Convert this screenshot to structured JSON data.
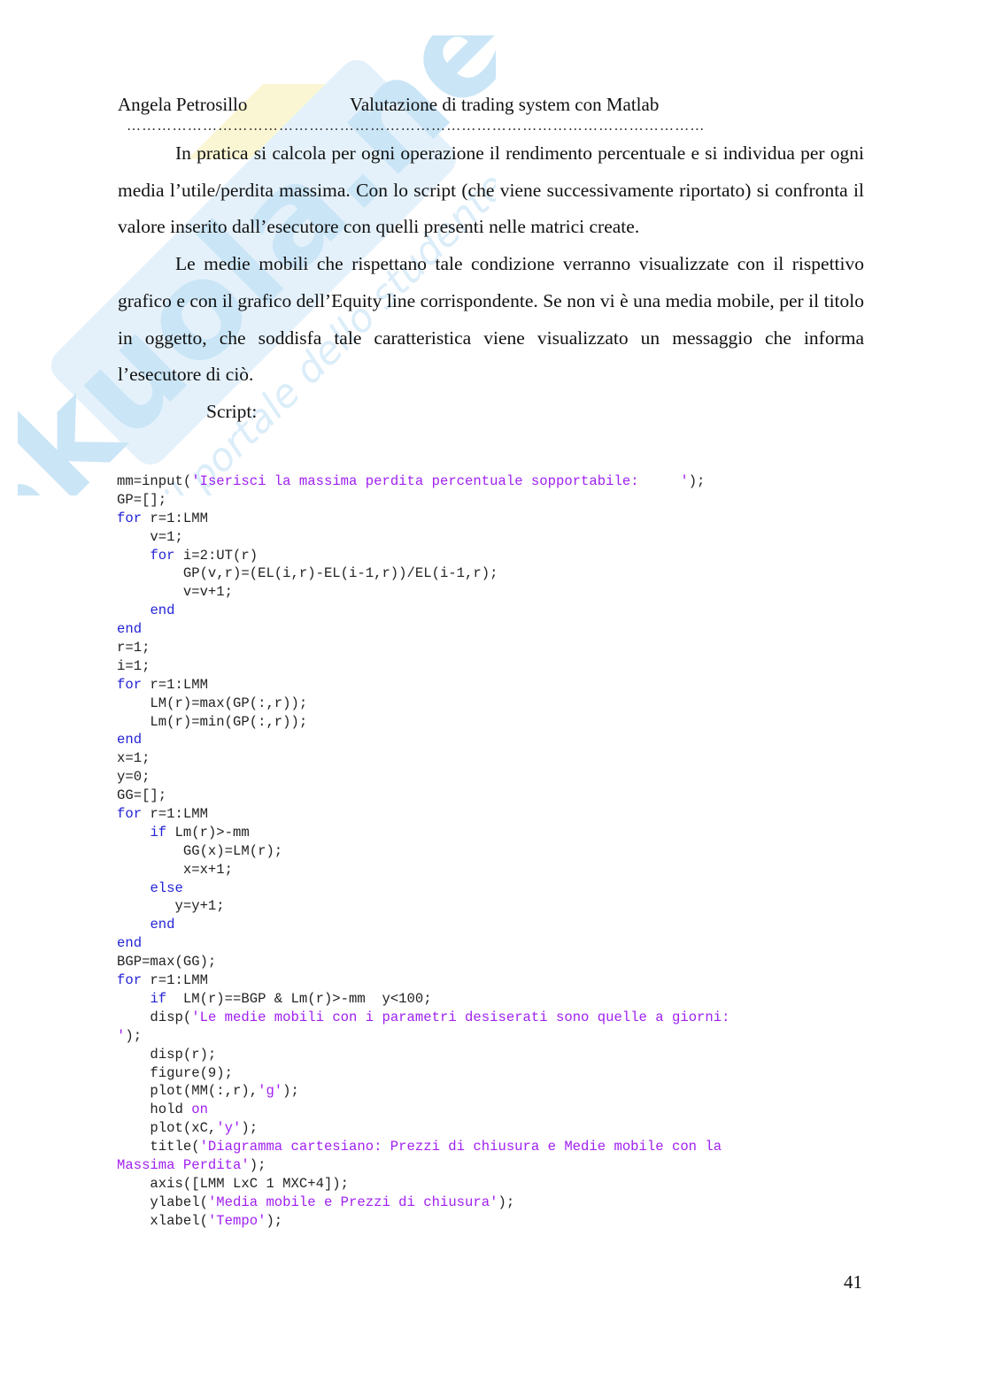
{
  "header": {
    "author": "Angela Petrosillo",
    "title": "Valutazione di trading system con Matlab",
    "separator": "……………………………………………………………………………………………………"
  },
  "watermark": {
    "brand": "Skuola.net",
    "tagline": "il portale dello studente",
    "colors": {
      "blue": "#a8d4f2",
      "yellow": "#f6f0a8"
    }
  },
  "body": {
    "paragraphs": [
      "In pratica si calcola per ogni operazione il rendimento percentuale e si individua per ogni media l’utile/perdita massima. Con lo script (che viene successivamente riportato) si confronta il valore inserito dall’esecutore con quelli presenti nelle matrici create.",
      "Le medie mobili che rispettano tale condizione verranno visualizzate con il rispettivo grafico e con il grafico dell’Equity line corrispondente. Se non vi è una media mobile, per il titolo in oggetto, che soddisfa tale caratteristica viene visualizzato un messaggio che informa l’esecutore di ciò."
    ],
    "script_label": "Script:"
  },
  "code_colors": {
    "keyword": "#2323d6",
    "string": "#a020f0",
    "default": "#222222"
  },
  "code": [
    [
      {
        "t": "mm=input("
      },
      {
        "t": "'Iserisci la massima perdita percentuale sopportabile:     '",
        "c": "str"
      },
      {
        "t": ");"
      }
    ],
    [
      {
        "t": "GP=[];"
      }
    ],
    [
      {
        "t": "for",
        "c": "kw"
      },
      {
        "t": " r=1:LMM"
      }
    ],
    [
      {
        "t": "    v=1;"
      }
    ],
    [
      {
        "t": "    "
      },
      {
        "t": "for",
        "c": "kw"
      },
      {
        "t": " i=2:UT(r)"
      }
    ],
    [
      {
        "t": "        GP(v,r)=(EL(i,r)-EL(i-1,r))/EL(i-1,r);"
      }
    ],
    [
      {
        "t": "        v=v+1;"
      }
    ],
    [
      {
        "t": "    "
      },
      {
        "t": "end",
        "c": "kw"
      }
    ],
    [
      {
        "t": "end",
        "c": "kw"
      }
    ],
    [
      {
        "t": "r=1;"
      }
    ],
    [
      {
        "t": "i=1;"
      }
    ],
    [
      {
        "t": "for",
        "c": "kw"
      },
      {
        "t": " r=1:LMM"
      }
    ],
    [
      {
        "t": "    LM(r)=max(GP(:,r));"
      }
    ],
    [
      {
        "t": "    Lm(r)=min(GP(:,r));"
      }
    ],
    [
      {
        "t": "end",
        "c": "kw"
      }
    ],
    [
      {
        "t": "x=1;"
      }
    ],
    [
      {
        "t": "y=0;"
      }
    ],
    [
      {
        "t": "GG=[];"
      }
    ],
    [
      {
        "t": "for",
        "c": "kw"
      },
      {
        "t": " r=1:LMM"
      }
    ],
    [
      {
        "t": "    "
      },
      {
        "t": "if",
        "c": "kw"
      },
      {
        "t": " Lm(r)>-mm"
      }
    ],
    [
      {
        "t": "        GG(x)=LM(r);"
      }
    ],
    [
      {
        "t": "        x=x+1;"
      }
    ],
    [
      {
        "t": "    "
      },
      {
        "t": "else",
        "c": "kw"
      }
    ],
    [
      {
        "t": "       y=y+1;"
      }
    ],
    [
      {
        "t": "    "
      },
      {
        "t": "end",
        "c": "kw"
      }
    ],
    [
      {
        "t": "end",
        "c": "kw"
      }
    ],
    [
      {
        "t": "BGP=max(GG);"
      }
    ],
    [
      {
        "t": "for",
        "c": "kw"
      },
      {
        "t": " r=1:LMM"
      }
    ],
    [
      {
        "t": "    "
      },
      {
        "t": "if",
        "c": "kw"
      },
      {
        "t": "  LM(r)==BGP & Lm(r)>-mm  y<100;"
      }
    ],
    [
      {
        "t": "    disp("
      },
      {
        "t": "'Le medie mobili con i parametri desiserati sono quelle a giorni:",
        "c": "str"
      }
    ],
    [
      {
        "t": "'",
        "c": "str"
      },
      {
        "t": ");"
      }
    ],
    [
      {
        "t": "    disp(r);"
      }
    ],
    [
      {
        "t": "    figure(9);"
      }
    ],
    [
      {
        "t": "    plot(MM(:,r),"
      },
      {
        "t": "'g'",
        "c": "str"
      },
      {
        "t": ");"
      }
    ],
    [
      {
        "t": "    hold "
      },
      {
        "t": "on",
        "c": "str"
      }
    ],
    [
      {
        "t": "    plot(xC,"
      },
      {
        "t": "'y'",
        "c": "str"
      },
      {
        "t": ");"
      }
    ],
    [
      {
        "t": "    title("
      },
      {
        "t": "'Diagramma cartesiano: Prezzi di chiusura e Medie mobile con la",
        "c": "str"
      }
    ],
    [
      {
        "t": "Massima Perdita'",
        "c": "str"
      },
      {
        "t": ");"
      }
    ],
    [
      {
        "t": "    axis([LMM LxC 1 MXC+4]);"
      }
    ],
    [
      {
        "t": "    ylabel("
      },
      {
        "t": "'Media mobile e Prezzi di chiusura'",
        "c": "str"
      },
      {
        "t": ");"
      }
    ],
    [
      {
        "t": "    xlabel("
      },
      {
        "t": "'Tempo'",
        "c": "str"
      },
      {
        "t": ");"
      }
    ]
  ],
  "footer": {
    "page_number": "41"
  }
}
